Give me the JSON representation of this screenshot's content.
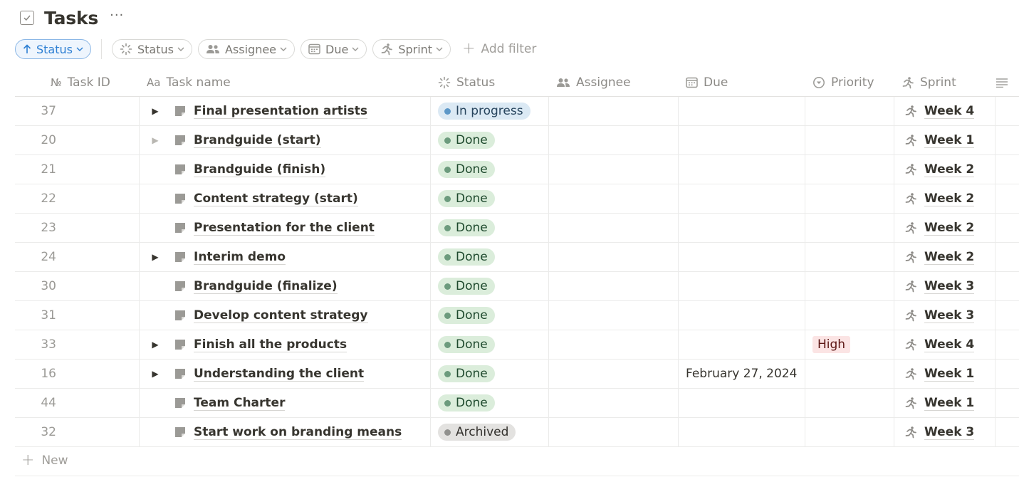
{
  "header": {
    "title": "Tasks",
    "more_label": "···"
  },
  "filters": {
    "sort_label": "Status",
    "chips": [
      {
        "label": "Status",
        "icon": "status-icon"
      },
      {
        "label": "Assignee",
        "icon": "people-icon"
      },
      {
        "label": "Due",
        "icon": "calendar-icon"
      },
      {
        "label": "Sprint",
        "icon": "runner-icon"
      }
    ],
    "add_filter_label": "Add filter"
  },
  "columns": {
    "id": "Task ID",
    "name": "Task name",
    "status": "Status",
    "assignee": "Assignee",
    "due": "Due",
    "priority": "Priority",
    "sprint": "Sprint"
  },
  "rows": [
    {
      "id": "37",
      "name": "Final presentation artists",
      "toggle": "solid",
      "status": "In progress",
      "status_kind": "progress",
      "assignee": "",
      "due": "",
      "priority": "",
      "sprint": "Week 4"
    },
    {
      "id": "20",
      "name": "Brandguide (start)",
      "toggle": "faded",
      "status": "Done",
      "status_kind": "done",
      "assignee": "",
      "due": "",
      "priority": "",
      "sprint": "Week 1"
    },
    {
      "id": "21",
      "name": "Brandguide (finish)",
      "toggle": "none",
      "status": "Done",
      "status_kind": "done",
      "assignee": "",
      "due": "",
      "priority": "",
      "sprint": "Week 2"
    },
    {
      "id": "22",
      "name": "Content strategy (start)",
      "toggle": "none",
      "status": "Done",
      "status_kind": "done",
      "assignee": "",
      "due": "",
      "priority": "",
      "sprint": "Week 2"
    },
    {
      "id": "23",
      "name": "Presentation for the client",
      "toggle": "none",
      "status": "Done",
      "status_kind": "done",
      "assignee": "",
      "due": "",
      "priority": "",
      "sprint": "Week 2"
    },
    {
      "id": "24",
      "name": "Interim demo",
      "toggle": "solid",
      "status": "Done",
      "status_kind": "done",
      "assignee": "",
      "due": "",
      "priority": "",
      "sprint": "Week 2"
    },
    {
      "id": "30",
      "name": "Brandguide (finalize)",
      "toggle": "none",
      "status": "Done",
      "status_kind": "done",
      "assignee": "",
      "due": "",
      "priority": "",
      "sprint": "Week 3"
    },
    {
      "id": "31",
      "name": "Develop content strategy",
      "toggle": "none",
      "status": "Done",
      "status_kind": "done",
      "assignee": "",
      "due": "",
      "priority": "",
      "sprint": "Week 3"
    },
    {
      "id": "33",
      "name": "Finish all the products",
      "toggle": "solid",
      "status": "Done",
      "status_kind": "done",
      "assignee": "",
      "due": "",
      "priority": "High",
      "sprint": "Week 4"
    },
    {
      "id": "16",
      "name": "Understanding the client",
      "toggle": "solid",
      "status": "Done",
      "status_kind": "done",
      "assignee": "",
      "due": "February 27, 2024",
      "priority": "",
      "sprint": "Week 1"
    },
    {
      "id": "44",
      "name": "Team Charter",
      "toggle": "none",
      "status": "Done",
      "status_kind": "done",
      "assignee": "",
      "due": "",
      "priority": "",
      "sprint": "Week 1"
    },
    {
      "id": "32",
      "name": "Start work on branding means",
      "toggle": "none",
      "status": "Archived",
      "status_kind": "archived",
      "assignee": "",
      "due": "",
      "priority": "",
      "sprint": "Week 3"
    }
  ],
  "footer": {
    "new_label": "New"
  },
  "colors": {
    "sort_accent": "#2d7fd3",
    "done_bg": "#dbeddb",
    "progress_bg": "#dbe9f4",
    "archived_bg": "#e3e2e0",
    "high_bg": "#fbe4e4"
  }
}
